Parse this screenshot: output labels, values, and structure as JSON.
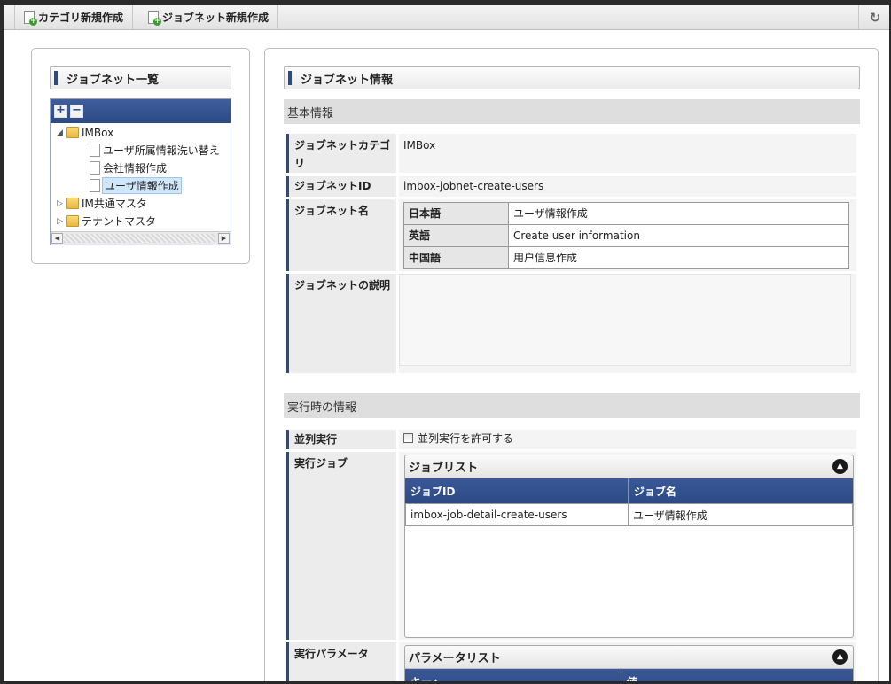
{
  "toolbar": {
    "new_category_label": "カテゴリ新規作成",
    "new_jobnet_label": "ジョブネット新規作成",
    "refresh_icon": "refresh-icon"
  },
  "sidebar": {
    "title": "ジョブネット一覧",
    "tree_buttons": [
      "+",
      "−"
    ],
    "tree": [
      {
        "label": "IMBox",
        "type": "folder",
        "expanded": true
      },
      {
        "label": "ユーザ所属情報洗い替え",
        "type": "page"
      },
      {
        "label": "会社情報作成",
        "type": "page"
      },
      {
        "label": "ユーザ情報作成",
        "type": "page",
        "selected": true
      },
      {
        "label": "IM共通マスタ",
        "type": "folder",
        "expanded": false
      },
      {
        "label": "テナントマスタ",
        "type": "folder",
        "expanded": false
      }
    ]
  },
  "main": {
    "title": "ジョブネット情報",
    "basic_section": "基本情報",
    "category": {
      "label": "ジョブネットカテゴリ",
      "value": "IMBox"
    },
    "jobnet_id": {
      "label": "ジョブネットID",
      "value": "imbox-jobnet-create-users"
    },
    "jobnet_name": {
      "label": "ジョブネット名",
      "rows": [
        {
          "lang": "日本語",
          "value": "ユーザ情報作成"
        },
        {
          "lang": "英語",
          "value": "Create user information"
        },
        {
          "lang": "中国語",
          "value": "用户信息作成"
        }
      ]
    },
    "description": {
      "label": "ジョブネットの説明",
      "value": ""
    },
    "runtime_section": "実行時の情報",
    "parallel": {
      "label": "並列実行",
      "checkbox_label": "並列実行を許可する",
      "checked": false
    },
    "jobs": {
      "label": "実行ジョブ",
      "panel_title": "ジョブリスト",
      "columns": [
        "ジョブID",
        "ジョブ名"
      ],
      "rows": [
        {
          "id": "imbox-job-detail-create-users",
          "name": "ユーザ情報作成"
        }
      ]
    },
    "params": {
      "label": "実行パラメータ",
      "panel_title": "パラメータリスト",
      "columns": [
        "キー▲",
        "値"
      ]
    }
  }
}
